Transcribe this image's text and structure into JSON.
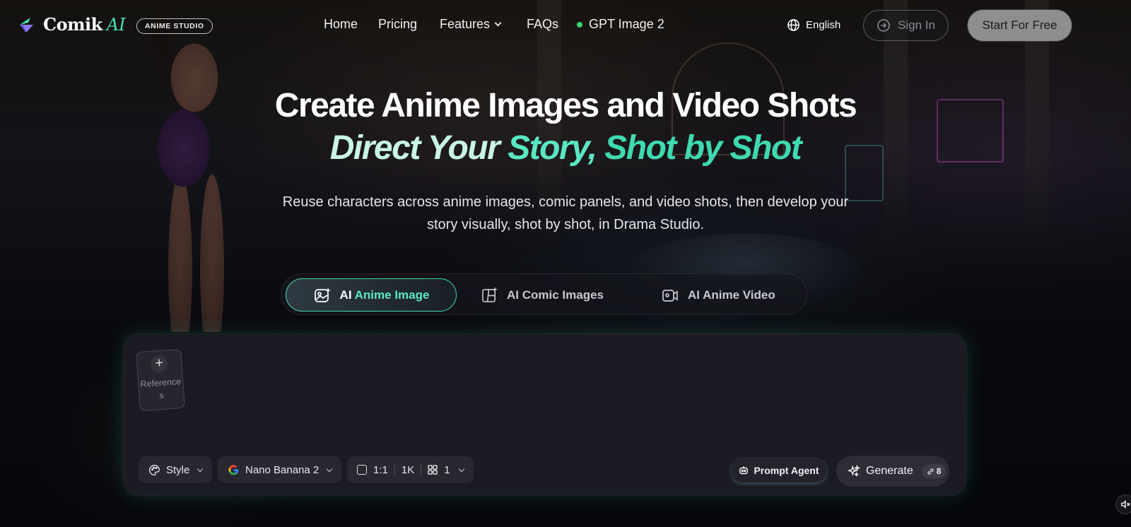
{
  "nav": {
    "logo_text": "Comik",
    "logo_ai": "AI",
    "badge": "ANIME STUDIO",
    "items": [
      {
        "label": "Home"
      },
      {
        "label": "Pricing"
      },
      {
        "label": "Features"
      },
      {
        "label": "FAQs"
      },
      {
        "label": "GPT Image 2"
      }
    ],
    "language": "English",
    "sign_in": "Sign In",
    "start": "Start For Free"
  },
  "hero": {
    "title": "Create Anime Images and Video Shots",
    "tagline_part1": "Direct Your",
    "tagline_part2": "Story,",
    "tagline_part3": "Shot by Shot",
    "subtitle": "Reuse characters across anime images, comic panels, and video shots, then develop your story visually, shot by shot, in Drama Studio."
  },
  "tabs": [
    {
      "label_pre": "AI ",
      "label_hl": "Anime Image",
      "active": true
    },
    {
      "label": "AI Comic Images"
    },
    {
      "label": "AI Anime Video"
    }
  ],
  "composer": {
    "references_label": "References",
    "style": "Style",
    "model": "Nano Banana 2",
    "ratio": "1:1",
    "resolution": "1K",
    "count": "1",
    "prompt_agent": "Prompt Agent",
    "generate": "Generate",
    "credits": "8"
  },
  "colors": {
    "accent": "#3fd9b0",
    "status_dot": "#3ad06b"
  }
}
